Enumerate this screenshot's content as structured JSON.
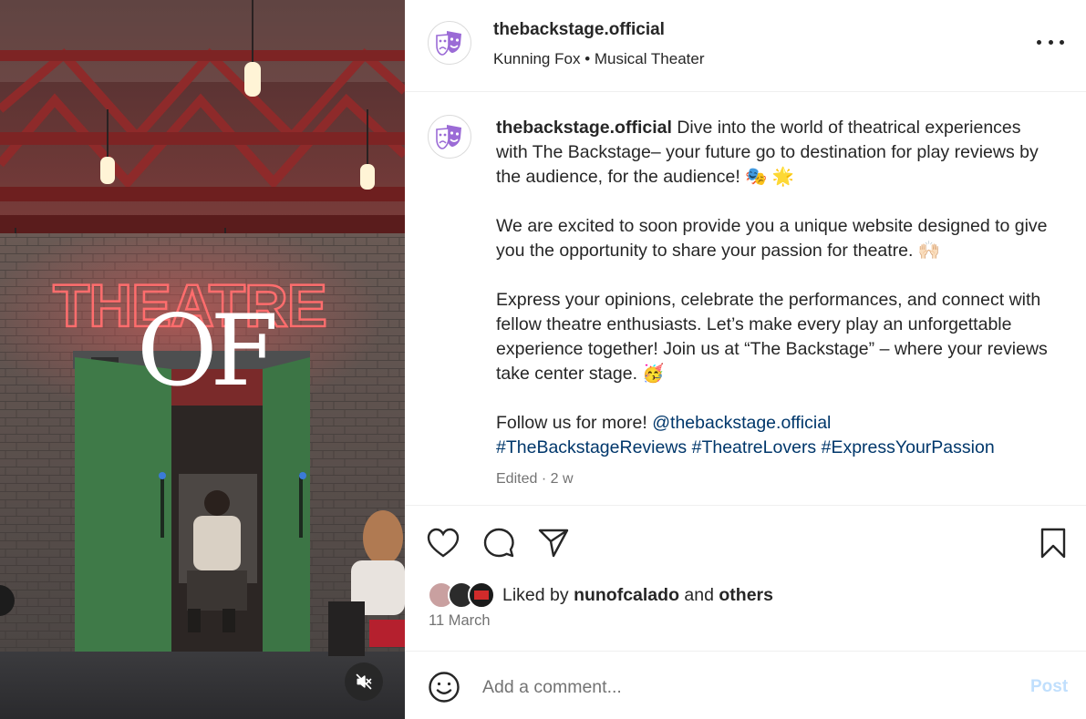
{
  "media": {
    "sign_text": "THEATRE",
    "overlay_text": "OF",
    "mute_icon": "volume-muted-icon"
  },
  "header": {
    "username": "thebackstage.official",
    "audio": "Kunning Fox",
    "separator": "•",
    "track": "Musical Theater",
    "more_icon": "more-horizontal-icon"
  },
  "caption": {
    "username": "thebackstage.official",
    "p1": "Dive into the world of theatrical experiences with The Backstage– your future go to destination for play reviews by the audience, for the audience! 🎭 🌟",
    "p2": "We are excited to soon provide you a unique website designed to give you the opportunity to share your passion for theatre. 🙌🏻",
    "p3": "Express your opinions, celebrate the performances, and connect with fellow theatre enthusiasts. Let’s make every play an unforgettable experience together! Join us at “The Backstage” – where your reviews take center stage. 🥳",
    "p4_prefix": "Follow us for more!",
    "mention": "@thebackstage.official",
    "hashtags": [
      "#TheBackstageReviews",
      "#TheatreLovers",
      "#ExpressYourPassion"
    ],
    "edited": "Edited",
    "time_separator": "·",
    "time": "2 w"
  },
  "actions": {
    "like_icon": "heart-icon",
    "comment_icon": "comment-icon",
    "share_icon": "share-icon",
    "save_icon": "bookmark-icon"
  },
  "likes": {
    "prefix": "Liked by",
    "user": "nunofcalado",
    "and": "and",
    "others": "others",
    "liker_colors": [
      "#c9a0a0",
      "#2b2b2b",
      "#d12b2b"
    ]
  },
  "date": "11 March",
  "comment": {
    "placeholder": "Add a comment...",
    "post_label": "Post",
    "emoji_icon": "emoji-smile-icon"
  },
  "colors": {
    "accent_purple": "#9b6bd6",
    "link": "#00376b",
    "post_disabled": "#c0dffd",
    "neon_red": "#ff5a5a",
    "door_green": "#3f7a48"
  }
}
